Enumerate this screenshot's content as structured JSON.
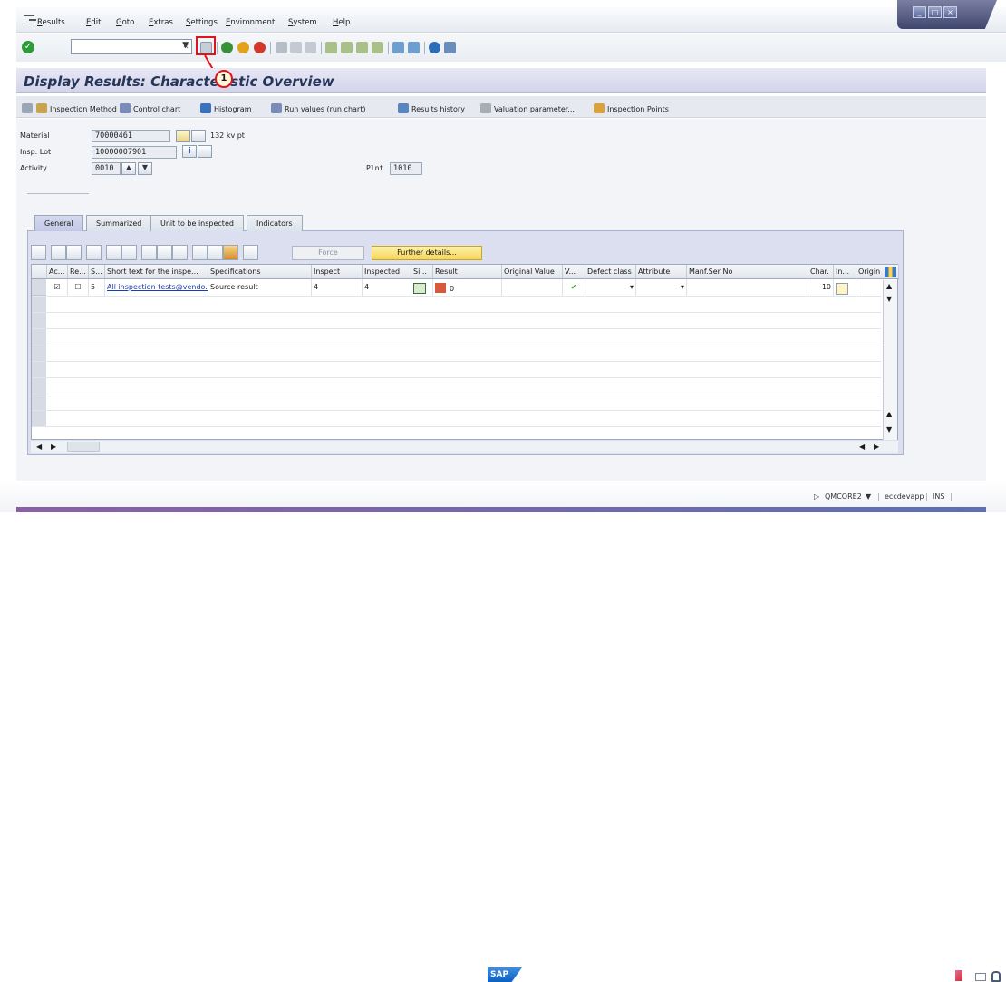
{
  "menubar": {
    "items": [
      "Results",
      "Edit",
      "Goto",
      "Extras",
      "Settings",
      "Environment",
      "System",
      "Help"
    ]
  },
  "toolbar": {
    "command_placeholder": ""
  },
  "callout": {
    "number": "1"
  },
  "title": "Display Results: Characteristic Overview",
  "app_toolbar": {
    "items": [
      "Inspection Method",
      "Control chart",
      "Histogram",
      "Run values (run chart)",
      "Results history",
      "Valuation parameter...",
      "Inspection Points"
    ]
  },
  "header": {
    "material_label": "Material",
    "material_value": "70000461",
    "material_desc": "132 kv pt",
    "lot_label": "Insp. Lot",
    "lot_value": "10000007901",
    "activity_label": "Activity",
    "activity_value": "0010",
    "plant_label": "Plnt",
    "plant_value": "1010"
  },
  "tabs": [
    "General",
    "Summarized",
    "Unit to be inspected",
    "Indicators"
  ],
  "buttons": {
    "force": "Force",
    "further": "Further details..."
  },
  "table": {
    "columns": [
      "Ac...",
      "Re...",
      "S...",
      "Short text for the inspe...",
      "Specifications",
      "Inspect",
      "Inspected",
      "Si...",
      "Result",
      "Original Value",
      "V...",
      "Defect class",
      "Attribute",
      "Manf.Ser No",
      "Char.",
      "In...",
      "Origin"
    ],
    "rows": [
      {
        "status": "5",
        "short_text": "All inspection tests@vendo...",
        "specifications": "Source result",
        "inspect": "4",
        "inspected": "4",
        "result": "0",
        "char": "10"
      }
    ]
  },
  "statusbar": {
    "system": "QMCORE2",
    "server": "eccdevapp",
    "mode": "INS"
  },
  "colors": {
    "accent": "#263659",
    "callout": "#e0151b"
  }
}
